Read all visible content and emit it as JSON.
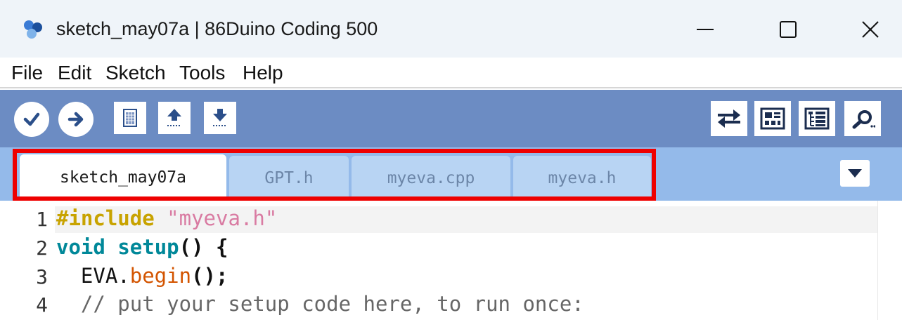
{
  "window": {
    "title": "sketch_may07a | 86Duino Coding 500",
    "controls": {
      "minimize": "minimize-icon",
      "maximize": "maximize-icon",
      "close": "close-icon"
    }
  },
  "menu": {
    "items": [
      "File",
      "Edit",
      "Sketch",
      "Tools",
      "Help"
    ]
  },
  "toolbar": {
    "left_buttons": [
      "verify-icon",
      "upload-icon",
      "new-icon",
      "open-icon",
      "save-icon"
    ],
    "right_buttons": [
      "serial-plotter-icon",
      "monitor-icon",
      "tree-icon",
      "serial-monitor-icon"
    ],
    "bg_color": "#6c8cc3"
  },
  "tabs": {
    "items": [
      {
        "label": "sketch_may07a",
        "active": true
      },
      {
        "label": "GPT.h",
        "active": false
      },
      {
        "label": "myeva.cpp",
        "active": false
      },
      {
        "label": "myeva.h",
        "active": false
      }
    ],
    "highlight_color": "#ee0000"
  },
  "editor": {
    "lines": [
      {
        "number": "1",
        "tokens": [
          {
            "text": "#include",
            "cls": "kw-inc"
          },
          {
            "text": " ",
            "cls": ""
          },
          {
            "text": "\"myeva.h\"",
            "cls": "str"
          }
        ]
      },
      {
        "number": "2",
        "tokens": [
          {
            "text": "void",
            "cls": "kw"
          },
          {
            "text": " ",
            "cls": ""
          },
          {
            "text": "setup",
            "cls": "kw"
          },
          {
            "text": "() {",
            "cls": "punc"
          }
        ]
      },
      {
        "number": "3",
        "tokens": [
          {
            "text": "  EVA.",
            "cls": ""
          },
          {
            "text": "begin",
            "cls": "fn"
          },
          {
            "text": "();",
            "cls": "punc"
          }
        ]
      },
      {
        "number": "4",
        "tokens": [
          {
            "text": "  // put your setup code here, to run once:",
            "cls": "cmt"
          }
        ]
      }
    ]
  }
}
